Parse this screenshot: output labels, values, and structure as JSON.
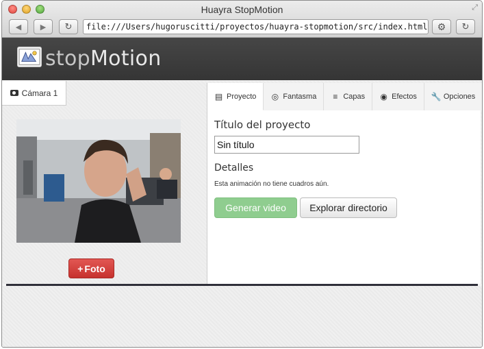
{
  "window": {
    "title": "Huayra StopMotion",
    "url": "file:///Users/hugoruscitti/proyectos/huayra-stopmotion/src/index.html"
  },
  "app": {
    "brand_light": "stop",
    "brand_bold": "Motion"
  },
  "left": {
    "camera_tab_label": "Cámara 1",
    "photo_button_label": "Foto",
    "photo_button_prefix": "+"
  },
  "tabs": [
    {
      "label": "Proyecto",
      "icon": "film-icon",
      "active": true
    },
    {
      "label": "Fantasma",
      "icon": "eye-slash-icon",
      "active": false
    },
    {
      "label": "Capas",
      "icon": "list-icon",
      "active": false
    },
    {
      "label": "Efectos",
      "icon": "eye-icon",
      "active": false
    },
    {
      "label": "Opciones",
      "icon": "wrench-icon",
      "active": false
    }
  ],
  "project": {
    "title_label": "Título del proyecto",
    "title_value": "Sin título",
    "details_label": "Detalles",
    "details_text": "Esta animación no tiene cuadros aún.",
    "generate_button": "Generar video",
    "explore_button": "Explorar directorio"
  },
  "colors": {
    "header_bg": "#3d3d3d",
    "success_btn": "#8fcd8f",
    "danger_btn": "#d9423e",
    "divider": "#2f2f39"
  }
}
